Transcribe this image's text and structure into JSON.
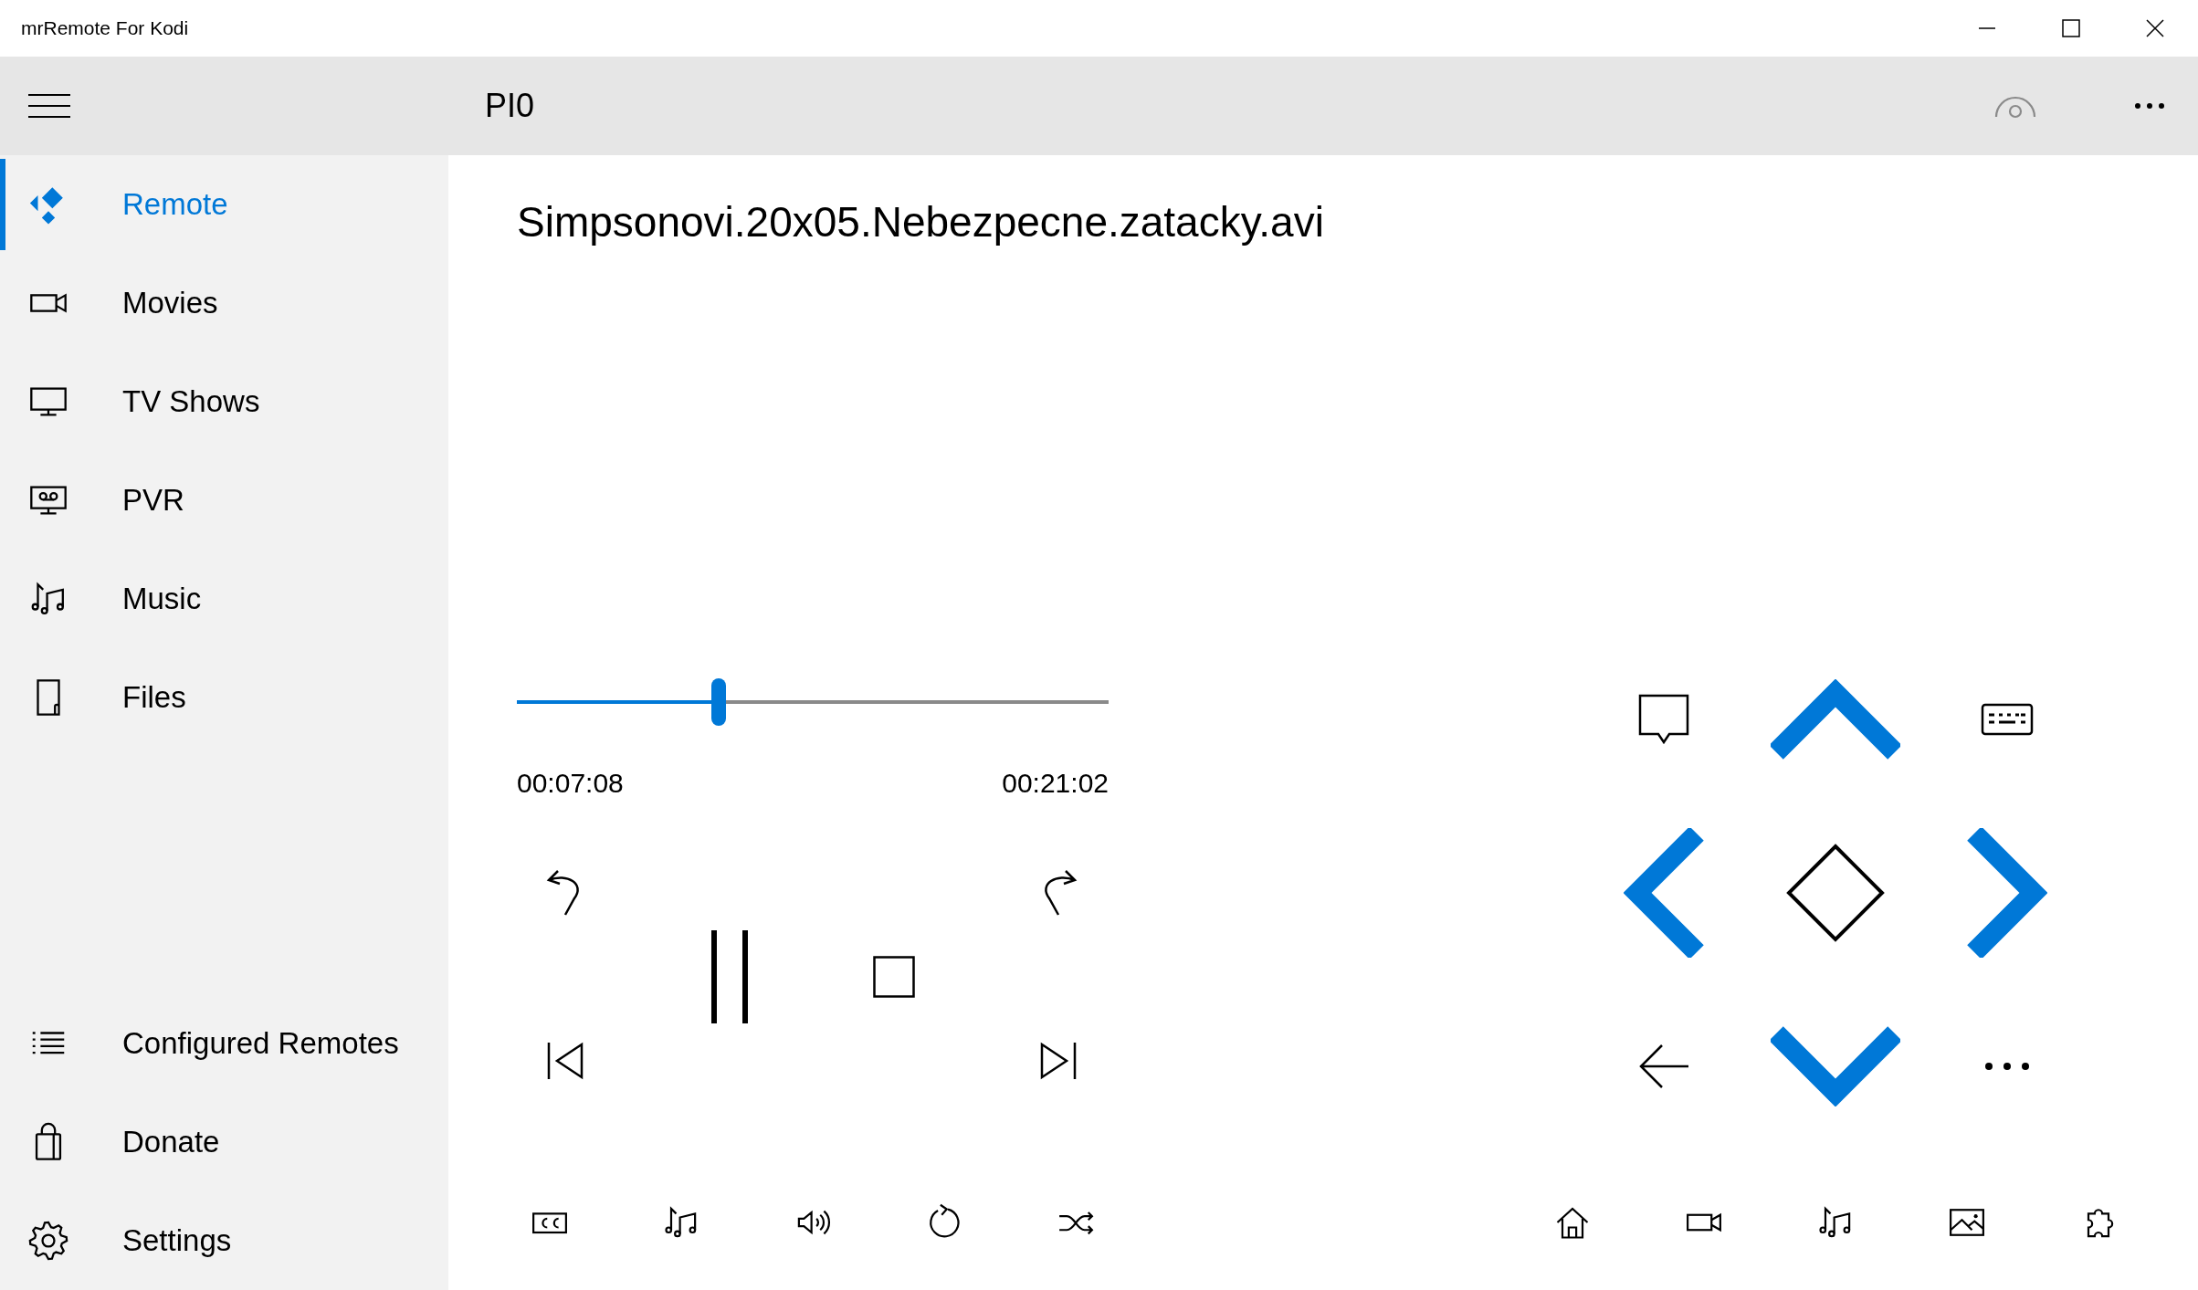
{
  "window": {
    "title": "mrRemote For Kodi"
  },
  "header": {
    "title": "PI0"
  },
  "sidebar": {
    "items": [
      {
        "label": "Remote",
        "selected": true
      },
      {
        "label": "Movies",
        "selected": false
      },
      {
        "label": "TV Shows",
        "selected": false
      },
      {
        "label": "PVR",
        "selected": false
      },
      {
        "label": "Music",
        "selected": false
      },
      {
        "label": "Files",
        "selected": false
      }
    ],
    "footer_items": [
      {
        "label": "Configured Remotes",
        "selected": false
      },
      {
        "label": "Donate",
        "selected": false
      },
      {
        "label": "Settings",
        "selected": false
      }
    ]
  },
  "now_playing": {
    "title": "Simpsonovi.20x05.Nebezpecne.zatacky.avi",
    "progress": {
      "level": 0.341
    },
    "elapsed": "00:07:08",
    "duration": "00:21:02"
  }
}
